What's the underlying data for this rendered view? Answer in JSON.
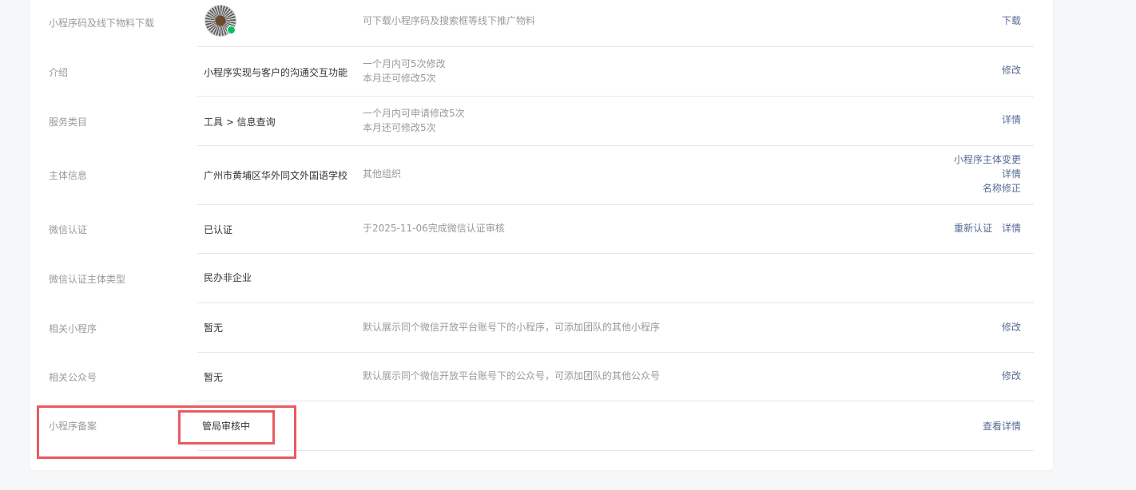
{
  "rows": [
    {
      "label": "小程序码及线下物料下载",
      "desc_lines": [
        "可下载小程序码及搜索框等线下推广物料"
      ],
      "actions": [
        "下载"
      ],
      "qr_icon": "qr-code-icon"
    },
    {
      "label": "介绍",
      "value": "小程序实现与客户的沟通交互功能",
      "desc_lines": [
        "一个月内可5次修改",
        "本月还可修改5次"
      ],
      "actions": [
        "修改"
      ]
    },
    {
      "label": "服务类目",
      "value": "工具 > 信息查询",
      "desc_lines": [
        "一个月内可申请修改5次",
        "本月还可修改5次"
      ],
      "actions": [
        "详情"
      ]
    },
    {
      "label": "主体信息",
      "value": "广州市黄埔区华外同文外国语学校",
      "desc_lines": [
        "其他组织"
      ],
      "actions": [
        "小程序主体变更",
        "详情",
        "名称修正"
      ]
    },
    {
      "label": "微信认证",
      "value": "已认证",
      "desc_lines": [
        "于2025-11-06完成微信认证审核"
      ],
      "actions": [
        "重新认证",
        "详情"
      ]
    },
    {
      "label": "微信认证主体类型",
      "value": "民办非企业",
      "desc_lines": [],
      "actions": []
    },
    {
      "label": "相关小程序",
      "value": "暂无",
      "desc_lines": [
        "默认展示同个微信开放平台账号下的小程序，可添加团队的其他小程序"
      ],
      "actions": [
        "修改"
      ]
    },
    {
      "label": "相关公众号",
      "value": "暂无",
      "desc_lines": [
        "默认展示同个微信开放平台账号下的公众号，可添加团队的其他公众号"
      ],
      "actions": [
        "修改"
      ]
    },
    {
      "label": "小程序备案",
      "value": "管局审核中",
      "desc_lines": [],
      "actions": [
        "查看详情"
      ]
    }
  ],
  "colors": {
    "link": "#576b95",
    "label": "#9a9a9a",
    "highlight": "#e95a5f",
    "divider": "#e7e7eb"
  }
}
